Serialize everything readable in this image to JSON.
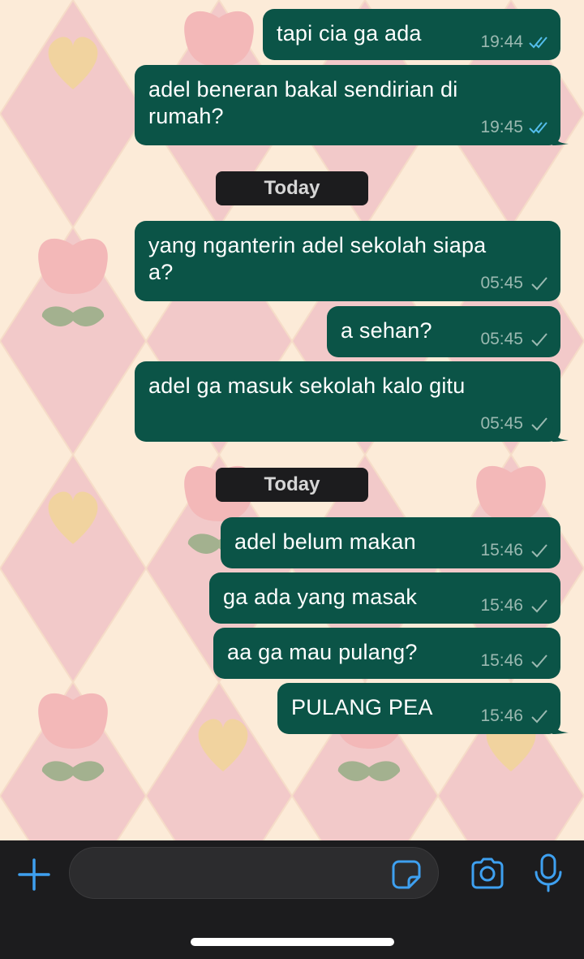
{
  "colors": {
    "bubble": "#0b5447",
    "tick_read": "#53bdeb",
    "tick_sent": "#9bb9b1",
    "accent": "#3ea0f0"
  },
  "messages": [
    {
      "text": "tapi cia ga ada",
      "time": "19:44",
      "status": "read"
    },
    {
      "text": "adel beneran bakal sendirian di\nrumah?",
      "time": "19:45",
      "status": "read"
    },
    {
      "text": "yang nganterin adel sekolah siapa\na?",
      "time": "05:45",
      "status": "sent"
    },
    {
      "text": "a sehan?",
      "time": "05:45",
      "status": "sent"
    },
    {
      "text": "adel ga masuk sekolah kalo gitu",
      "time": "05:45",
      "status": "sent"
    },
    {
      "text": "adel belum makan",
      "time": "15:46",
      "status": "sent"
    },
    {
      "text": "ga ada yang masak",
      "time": "15:46",
      "status": "sent"
    },
    {
      "text": "aa ga mau pulang?",
      "time": "15:46",
      "status": "sent"
    },
    {
      "text": "PULANG PEA",
      "time": "15:46",
      "status": "sent"
    }
  ],
  "date_separators": [
    "Today",
    "Today"
  ],
  "composer": {
    "value": "",
    "placeholder": ""
  },
  "icons": {
    "attach": "plus-icon",
    "sticker": "sticker-icon",
    "camera": "camera-icon",
    "mic": "microphone-icon"
  }
}
